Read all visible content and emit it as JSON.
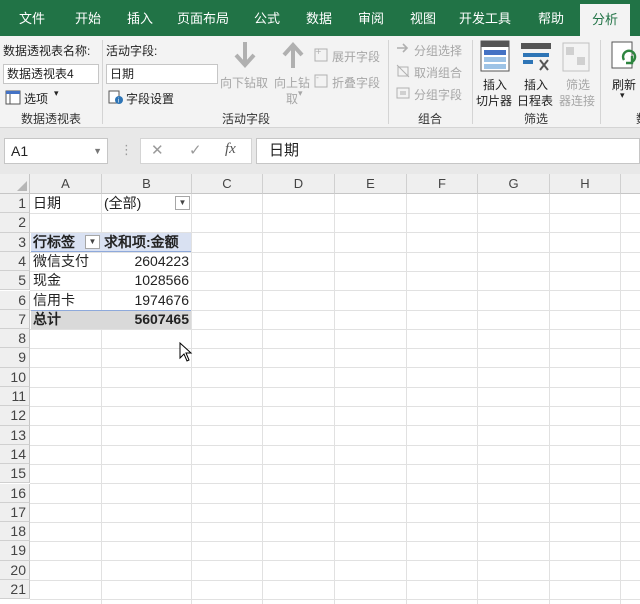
{
  "ribbon_tabs": [
    "文件",
    "开始",
    "插入",
    "页面布局",
    "公式",
    "数据",
    "审阅",
    "视图",
    "开发工具",
    "帮助",
    "分析"
  ],
  "active_tab": "分析",
  "pivot_group": {
    "name_label": "数据透视表名称:",
    "name_value": "数据透视表4",
    "options_label": "选项",
    "group_label": "数据透视表"
  },
  "active_field_group": {
    "field_label": "活动字段:",
    "field_value": "日期",
    "field_settings": "字段设置",
    "drill_down": [
      "向下钻取"
    ],
    "drill_up": [
      "向上钻",
      "取"
    ],
    "expand_field": "展开字段",
    "collapse_field": "折叠字段",
    "group_label": "活动字段"
  },
  "group_group": {
    "group_selection": "分组选择",
    "ungroup": "取消组合",
    "group_field": "分组字段",
    "group_label": "组合"
  },
  "filter_group": {
    "insert_slicer": [
      "插入",
      "切片器"
    ],
    "insert_timeline": [
      "插入",
      "日程表"
    ],
    "filter_connections": [
      "筛选",
      "器连接"
    ],
    "group_label": "筛选"
  },
  "data_group": {
    "refresh": "刷新",
    "partial_label": "数"
  },
  "formula_bar": {
    "name_box": "A1",
    "formula": "日期",
    "fx": "fx",
    "cancel": "✕",
    "enter": "✓"
  },
  "columns": [
    "A",
    "B",
    "C",
    "D",
    "E",
    "F",
    "G",
    "H"
  ],
  "rows": [
    "1",
    "2",
    "3",
    "4",
    "5",
    "6",
    "7",
    "8",
    "9",
    "10",
    "11",
    "12",
    "13",
    "14",
    "15",
    "16",
    "17",
    "18",
    "19",
    "20",
    "21"
  ],
  "pivot": {
    "filter_field": "日期",
    "filter_value": "(全部)",
    "row_label_header": "行标签",
    "value_header": "求和项:金额",
    "rows": [
      {
        "label": "微信支付",
        "value": "2604223"
      },
      {
        "label": "现金",
        "value": "1028566"
      },
      {
        "label": "信用卡",
        "value": "1974676"
      }
    ],
    "total_label": "总计",
    "total_value": "5607465"
  },
  "colors": {
    "ribbon_green": "#217346",
    "header_band": "#d9e1f2",
    "total_band": "#d9d9d9"
  }
}
